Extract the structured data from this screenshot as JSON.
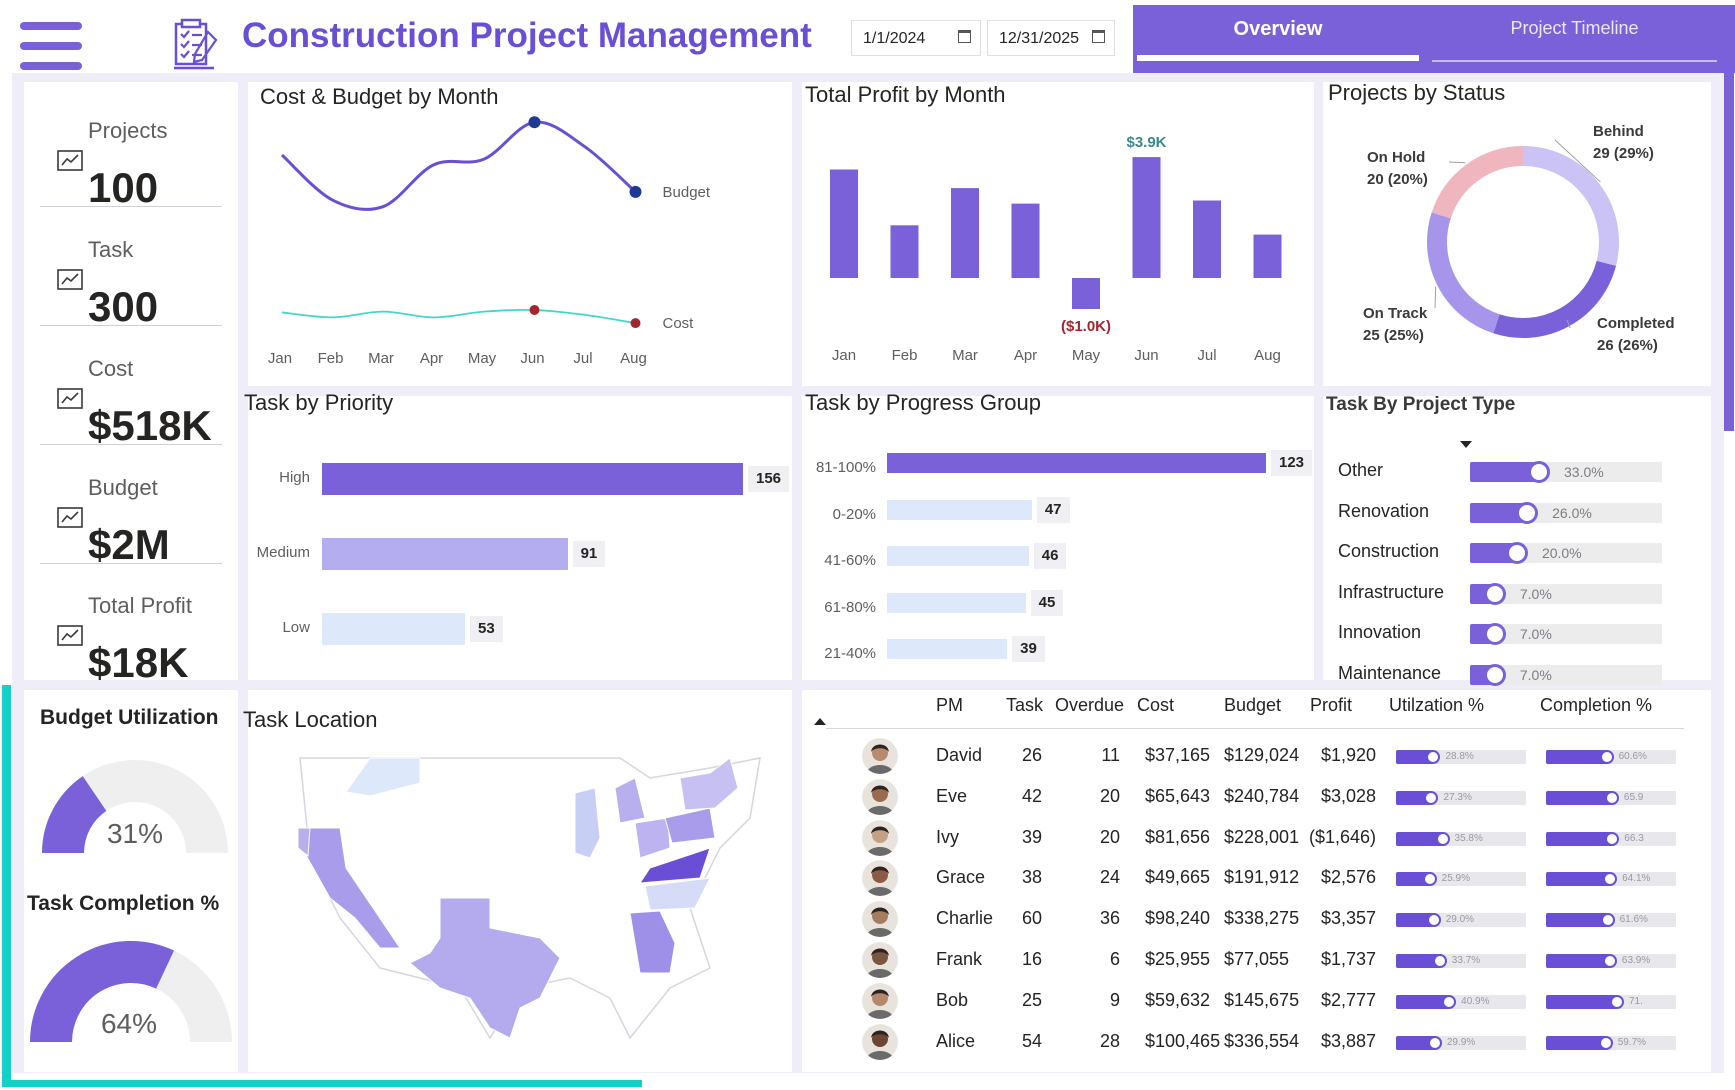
{
  "header": {
    "title": "Construction Project Management",
    "start_date": "1/1/2024",
    "end_date": "12/31/2025",
    "menu_icon": "hamburger-menu-icon",
    "title_icon": "project-checklist-icon"
  },
  "tabs": [
    {
      "label": "Overview",
      "active": true
    },
    {
      "label": "Project Timeline",
      "active": false
    }
  ],
  "colors": {
    "accent": "#7b61d9",
    "title": "#6a4fd6",
    "teal": "#13d1c6",
    "budget_line": "#6a4fd6",
    "cost_line": "#40d6cf",
    "negative_label": "#a4262c",
    "positive_label": "#3a8a8a"
  },
  "kpis": [
    {
      "label": "Projects",
      "value": "100",
      "icon": "blueprint-chart-icon"
    },
    {
      "label": "Task",
      "value": "300",
      "icon": "task-chart-icon"
    },
    {
      "label": "Cost",
      "value": "$518K",
      "icon": "cost-document-icon"
    },
    {
      "label": "Budget",
      "value": "$2M",
      "icon": "budget-calculator-icon"
    },
    {
      "label": "Total Profit",
      "value": "$18K",
      "icon": "profit-building-icon"
    }
  ],
  "gauges": {
    "budget_utilization": {
      "title": "Budget Utilization",
      "label": "31%",
      "value": 0.31
    },
    "task_completion": {
      "title": "Task Completion %",
      "label": "64%",
      "value": 0.64
    }
  },
  "chart_data": [
    {
      "type": "line",
      "title": "Cost & Budget by Month",
      "categories": [
        "Jan",
        "Feb",
        "Mar",
        "Apr",
        "May",
        "Jun",
        "Jul",
        "Aug"
      ],
      "series": [
        {
          "name": "Budget",
          "values": [
            250,
            195,
            187,
            238,
            245,
            290,
            260,
            205
          ]
        },
        {
          "name": "Cost",
          "values": [
            58,
            52,
            59,
            52,
            59,
            61,
            55,
            45
          ]
        }
      ]
    },
    {
      "type": "bar",
      "title": "Total Profit by Month",
      "categories": [
        "Jan",
        "Feb",
        "Mar",
        "Apr",
        "May",
        "Jun",
        "Jul",
        "Aug"
      ],
      "values": [
        3.5,
        1.7,
        2.9,
        2.4,
        -1.0,
        3.9,
        2.5,
        1.4
      ],
      "data_labels": {
        "Jun": "$3.9K",
        "May": "($1.0K)"
      }
    },
    {
      "type": "pie",
      "title": "Projects by Status",
      "series": [
        {
          "name": "Behind",
          "value": 29,
          "label": "29 (29%)",
          "color": "#cbc2f5"
        },
        {
          "name": "Completed",
          "value": 26,
          "label": "26 (26%)",
          "color": "#7b61d9"
        },
        {
          "name": "On Track",
          "value": 25,
          "label": "25 (25%)",
          "color": "#a695ea"
        },
        {
          "name": "On Hold",
          "value": 20,
          "label": "20 (20%)",
          "color": "#f0b6c0"
        }
      ]
    },
    {
      "type": "bar",
      "title": "Task by Priority",
      "categories": [
        "High",
        "Medium",
        "Low"
      ],
      "values": [
        156,
        91,
        53
      ],
      "colors": [
        "#7b61d9",
        "#b4aef0",
        "#dde9fb"
      ]
    },
    {
      "type": "bar",
      "title": "Task by Progress Group",
      "categories": [
        "81-100%",
        "0-20%",
        "41-60%",
        "61-80%",
        "21-40%"
      ],
      "values": [
        123,
        47,
        46,
        45,
        39
      ],
      "colors": [
        "#7b61d9",
        "#dde9fb",
        "#dde9fb",
        "#dde9fb",
        "#dde9fb"
      ]
    },
    {
      "type": "bar",
      "title": "Task By Project Type",
      "categories": [
        "Other",
        "Renovation",
        "Construction",
        "Infrastructure",
        "Innovation",
        "Maintenance"
      ],
      "values": [
        33.0,
        26.0,
        20.0,
        7.0,
        7.0,
        7.0
      ],
      "labels": [
        "33.0%",
        "26.0%",
        "20.0%",
        "7.0%",
        "7.0%",
        "7.0%"
      ]
    }
  ],
  "map": {
    "title": "Task Location"
  },
  "table": {
    "columns": [
      "PM",
      "Task",
      "Overdue",
      "Cost",
      "Budget",
      "Profit",
      "Utilzation %",
      "Completion %"
    ],
    "rows": [
      {
        "pm": "David",
        "task": "26",
        "overdue": "11",
        "cost": "$37,165",
        "budget": "$129,024",
        "profit": "$1,920",
        "util": 28.8,
        "util_label": "28.8%",
        "comp": 60.6,
        "comp_label": "60.6%"
      },
      {
        "pm": "Eve",
        "task": "42",
        "overdue": "20",
        "cost": "$65,643",
        "budget": "$240,784",
        "profit": "$3,028",
        "util": 27.3,
        "util_label": "27.3%",
        "comp": 65.9,
        "comp_label": "65.9"
      },
      {
        "pm": "Ivy",
        "task": "39",
        "overdue": "20",
        "cost": "$81,656",
        "budget": "$228,001",
        "profit": "($1,646)",
        "util": 35.8,
        "util_label": "35.8%",
        "comp": 66.3,
        "comp_label": "66.3"
      },
      {
        "pm": "Grace",
        "task": "38",
        "overdue": "24",
        "cost": "$49,665",
        "budget": "$191,912",
        "profit": "$2,576",
        "util": 25.9,
        "util_label": "25.9%",
        "comp": 64.1,
        "comp_label": "64.1%"
      },
      {
        "pm": "Charlie",
        "task": "60",
        "overdue": "36",
        "cost": "$98,240",
        "budget": "$338,275",
        "profit": "$3,357",
        "util": 29.0,
        "util_label": "29.0%",
        "comp": 61.6,
        "comp_label": "61.6%"
      },
      {
        "pm": "Frank",
        "task": "16",
        "overdue": "6",
        "cost": "$25,955",
        "budget": "$77,055",
        "profit": "$1,737",
        "util": 33.7,
        "util_label": "33.7%",
        "comp": 63.9,
        "comp_label": "63.9%"
      },
      {
        "pm": "Bob",
        "task": "25",
        "overdue": "9",
        "cost": "$59,632",
        "budget": "$145,675",
        "profit": "$2,777",
        "util": 40.9,
        "util_label": "40.9%",
        "comp": 71.0,
        "comp_label": "71."
      },
      {
        "pm": "Alice",
        "task": "54",
        "overdue": "28",
        "cost": "$100,465",
        "budget": "$336,554",
        "profit": "$3,887",
        "util": 29.9,
        "util_label": "29.9%",
        "comp": 59.7,
        "comp_label": "59.7%"
      }
    ]
  }
}
